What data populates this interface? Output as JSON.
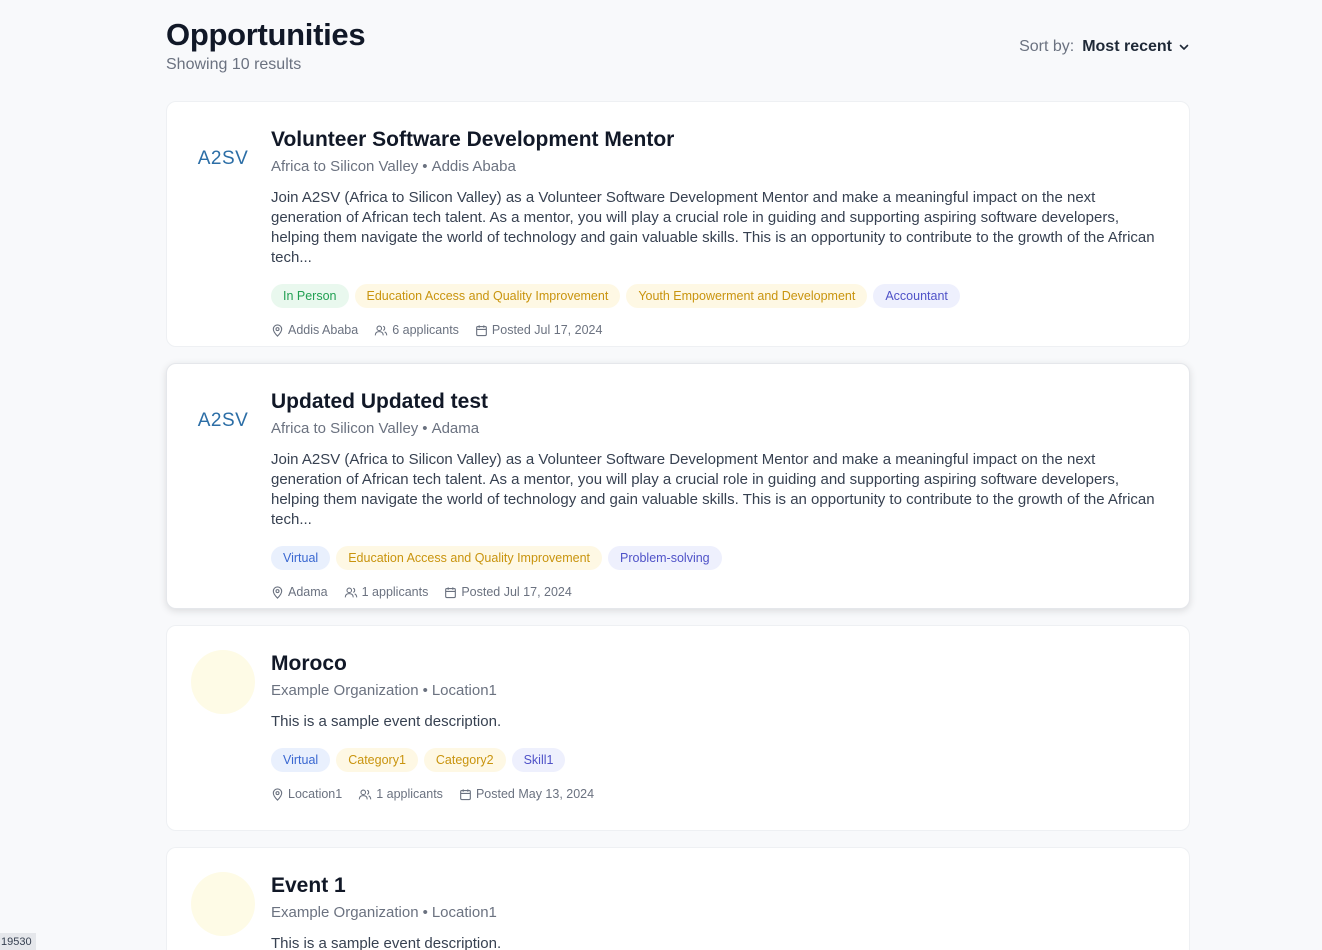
{
  "header": {
    "title": "Opportunities",
    "results": "Showing 10 results",
    "sort_label": "Sort by:",
    "sort_value": "Most recent"
  },
  "cards": [
    {
      "title": "Volunteer Software Development Mentor",
      "org": "Africa to Silicon Valley",
      "location": "Addis Ababa",
      "logo": "A2SV",
      "description": "Join A2SV (Africa to Silicon Valley) as a Volunteer Software Development Mentor and make a meaningful impact on the next generation of African tech talent. As a mentor, you will play a crucial role in guiding and supporting aspiring software developers, helping them navigate the world of technology and gain valuable skills. This is an opportunity to contribute to the growth of the African tech...",
      "tags": [
        "In Person",
        "Education Access and Quality Improvement",
        "Youth Empowerment and Development",
        "Accountant"
      ],
      "meta_location": "Addis Ababa",
      "applicants": "6 applicants",
      "posted": "Posted Jul 17, 2024"
    },
    {
      "title": "Updated Updated test",
      "org": "Africa to Silicon Valley",
      "location": "Adama",
      "logo": "A2SV",
      "description": "Join A2SV (Africa to Silicon Valley) as a Volunteer Software Development Mentor and make a meaningful impact on the next generation of African tech talent. As a mentor, you will play a crucial role in guiding and supporting aspiring software developers, helping them navigate the world of technology and gain valuable skills. This is an opportunity to contribute to the growth of the African tech...",
      "tags": [
        "Virtual",
        "Education Access and Quality Improvement",
        "Problem-solving"
      ],
      "meta_location": "Adama",
      "applicants": "1 applicants",
      "posted": "Posted Jul 17, 2024"
    },
    {
      "title": "Moroco",
      "org": "Example Organization",
      "location": "Location1",
      "description": "This is a sample event description.",
      "tags": [
        "Virtual",
        "Category1",
        "Category2",
        "Skill1"
      ],
      "meta_location": "Location1",
      "applicants": "1 applicants",
      "posted": "Posted May 13, 2024"
    },
    {
      "title": "Event 1",
      "org": "Example Organization",
      "location": "Location1",
      "description": "This is a sample event description."
    }
  ],
  "colors": {
    "green_tag": "#22a053",
    "yellow_tag": "#c9940e",
    "indigo_tag": "#4f52c8",
    "blue_tag": "#3967d1"
  },
  "corner_badge": "19530"
}
